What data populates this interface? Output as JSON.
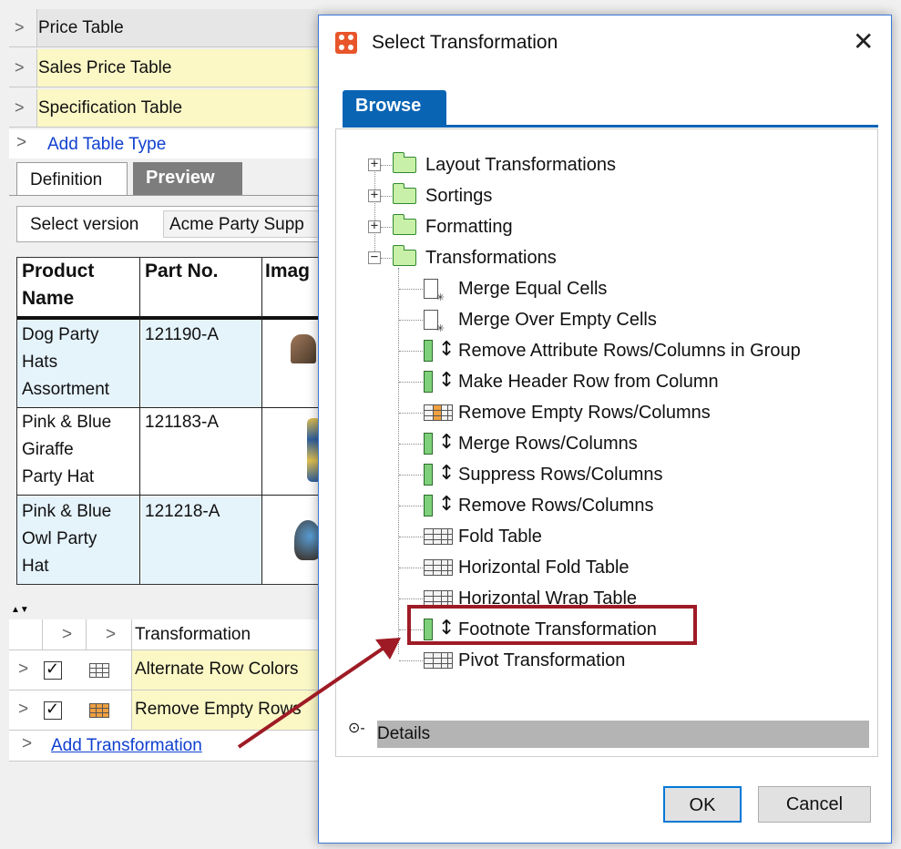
{
  "table_types": {
    "items": [
      {
        "label": "Price Table"
      },
      {
        "label": "Sales Price Table"
      },
      {
        "label": "Specification Table"
      }
    ],
    "add_label": "Add Table Type"
  },
  "tabs": {
    "definition": "Definition",
    "preview": "Preview"
  },
  "version": {
    "label": "Select version",
    "value": "Acme Party Supp"
  },
  "product_table": {
    "headers": [
      "Product\nName",
      "Part No.",
      "Imag"
    ],
    "rows": [
      {
        "name_lines": [
          "Dog Party",
          "Hats",
          "Assortment"
        ],
        "part": "121190-A"
      },
      {
        "name_lines": [
          "Pink & Blue",
          "Giraffe",
          "Party Hat"
        ],
        "part": "121183-A"
      },
      {
        "name_lines": [
          "Pink & Blue",
          "Owl Party",
          "Hat"
        ],
        "part": "121218-A"
      }
    ]
  },
  "transformations_panel": {
    "header": "Transformation",
    "rows": [
      {
        "label": "Alternate Row Colors",
        "checked": true
      },
      {
        "label": "Remove Empty Rows",
        "checked": true
      }
    ],
    "add_label": "Add Transformation"
  },
  "dialog": {
    "title": "Select Transformation",
    "tab": "Browse",
    "tree": {
      "folders": [
        {
          "label": "Layout Transformations",
          "expanded": false
        },
        {
          "label": "Sortings",
          "expanded": false
        },
        {
          "label": "Formatting",
          "expanded": false
        },
        {
          "label": "Transformations",
          "expanded": true
        }
      ],
      "children": [
        {
          "label": "Merge Equal Cells",
          "icon": "doc-asterisk-icon"
        },
        {
          "label": "Merge Over Empty Cells",
          "icon": "doc-asterisk-icon"
        },
        {
          "label": "Remove Attribute Rows/Columns in Group",
          "icon": "bar-arrow-icon"
        },
        {
          "label": "Make Header Row from Column",
          "icon": "bar-arrow-icon"
        },
        {
          "label": "Remove Empty Rows/Columns",
          "icon": "table-orange-icon"
        },
        {
          "label": "Merge Rows/Columns",
          "icon": "bar-arrow-icon"
        },
        {
          "label": "Suppress Rows/Columns",
          "icon": "bar-arrow-icon"
        },
        {
          "label": "Remove Rows/Columns",
          "icon": "bar-arrow-icon"
        },
        {
          "label": "Fold Table",
          "icon": "table-icon"
        },
        {
          "label": "Horizontal Fold Table",
          "icon": "table-icon"
        },
        {
          "label": "Horizontal Wrap Table",
          "icon": "table-icon"
        },
        {
          "label": "Footnote Transformation",
          "icon": "bar-arrow-icon"
        },
        {
          "label": "Pivot Transformation",
          "icon": "table-icon"
        }
      ]
    },
    "details_label": "Details",
    "ok_label": "OK",
    "cancel_label": "Cancel"
  },
  "colors": {
    "highlight": "#9e1b25",
    "tab_blue": "#0a64b4",
    "selected_row": "#fbf8c6",
    "product_cell_blue": "#e5f3fb"
  }
}
